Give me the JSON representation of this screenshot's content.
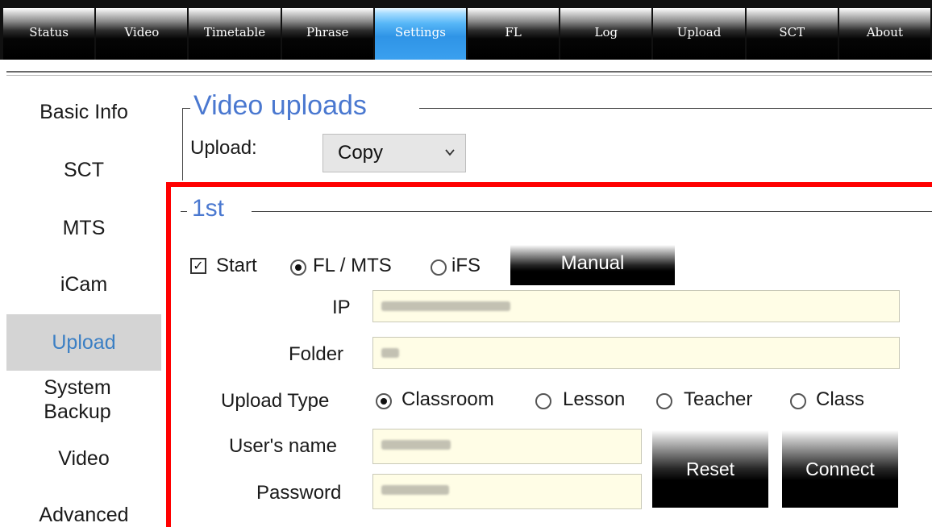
{
  "topnav": {
    "tabs": [
      {
        "label": "Status"
      },
      {
        "label": "Video"
      },
      {
        "label": "Timetable"
      },
      {
        "label": "Phrase"
      },
      {
        "label": "Settings"
      },
      {
        "label": "FL"
      },
      {
        "label": "Log"
      },
      {
        "label": "Upload"
      },
      {
        "label": "SCT"
      },
      {
        "label": "About"
      }
    ],
    "active_tab": "Settings"
  },
  "sidebar": {
    "items": [
      {
        "label": "Basic Info"
      },
      {
        "label": "SCT"
      },
      {
        "label": "MTS"
      },
      {
        "label": "iCam"
      },
      {
        "label": "Upload"
      },
      {
        "label": "System Backup"
      },
      {
        "label": "Video"
      },
      {
        "label": "Advanced"
      }
    ],
    "active_item": "Upload"
  },
  "video_uploads": {
    "legend": "Video uploads",
    "upload_label": "Upload:",
    "upload_value": "Copy"
  },
  "first": {
    "legend": "1st",
    "start_label": "Start",
    "start_checked": true,
    "mode_options": [
      "FL / MTS",
      "iFS"
    ],
    "mode_selected": "FL / MTS",
    "manual_button": "Manual",
    "ip_label": "IP",
    "folder_label": "Folder",
    "upload_type_label": "Upload Type",
    "upload_type_options": [
      "Classroom",
      "Lesson",
      "Teacher",
      "Class"
    ],
    "upload_type_selected": "Classroom",
    "username_label": "User's name",
    "password_label": "Password",
    "reset_button": "Reset",
    "connect_button": "Connect"
  },
  "colors": {
    "accent": "#4a78d0",
    "highlight_box": "#ff0000",
    "input_bg": "#fffde6",
    "active_tab": "#3aa0ef"
  }
}
